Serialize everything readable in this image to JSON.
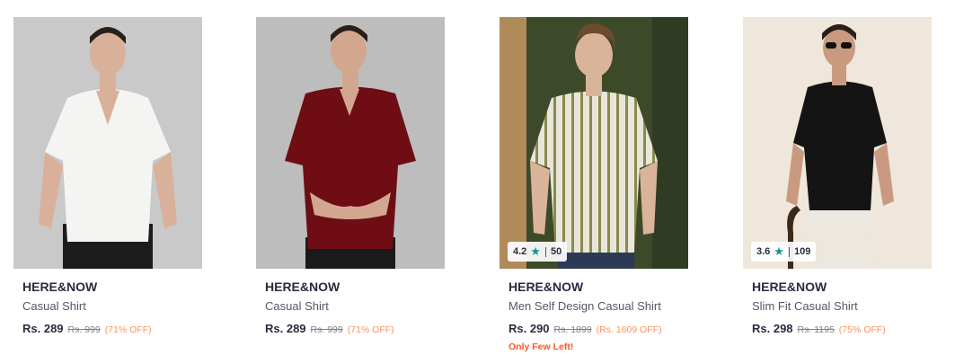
{
  "products": [
    {
      "brand": "HERE&NOW",
      "name": "Casual Shirt",
      "price": "Rs. 289",
      "mrp": "Rs. 999",
      "discount": "(71% OFF)",
      "image": {
        "background": "#c9c9c9",
        "shirt_color": "#f4f4f2",
        "pants_color": "#1c1c1c"
      }
    },
    {
      "brand": "HERE&NOW",
      "name": "Casual Shirt",
      "price": "Rs. 289",
      "mrp": "Rs. 999",
      "discount": "(71% OFF)",
      "image": {
        "background": "#bdbdbd",
        "shirt_color": "#6e0d14",
        "pants_color": "#1a1a1a"
      }
    },
    {
      "brand": "HERE&NOW",
      "name": "Men Self Design Casual Shirt",
      "price": "Rs. 290",
      "mrp": "Rs. 1899",
      "discount": "(Rs. 1609 OFF)",
      "stock_note": "Only Few Left!",
      "rating": {
        "score": "4.2",
        "count": "50"
      },
      "image": {
        "background": "#3d4a2a",
        "shirt_color": "#e8e6da",
        "stripe_color": "#8b8a4e",
        "pants_color": "#2c3a55"
      }
    },
    {
      "brand": "HERE&NOW",
      "name": "Slim Fit Casual Shirt",
      "price": "Rs. 298",
      "mrp": "Rs. 1195",
      "discount": "(75% OFF)",
      "rating": {
        "score": "3.6",
        "count": "109"
      },
      "image": {
        "background": "#efe6dc",
        "shirt_color": "#141414",
        "pants_color": "#ece8e0"
      }
    }
  ],
  "colors": {
    "brand_text": "#282c3f",
    "name_text": "#535766",
    "mrp_text": "#7e818c",
    "discount_text": "#ff905a",
    "stock_note_text": "#ff5722",
    "rating_star": "#14958f"
  }
}
